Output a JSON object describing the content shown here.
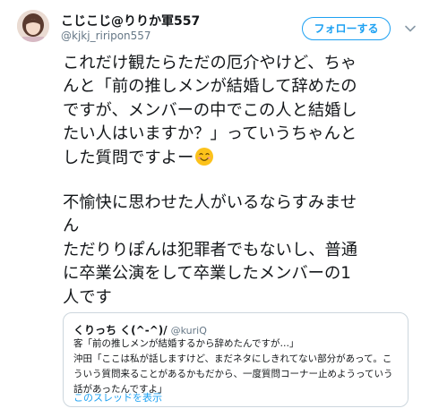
{
  "author": {
    "display_name": "こじこじ@りりか軍557",
    "handle": "@kjkj_riripon557",
    "avatar_icon": "avatar-photo"
  },
  "follow_button": {
    "label": "フォローする"
  },
  "menu_icon": "chevron-down-icon",
  "tweet": {
    "lines": [
      "これだけ観たらただの厄介やけど、ちゃ",
      "んと「前の推しメンが結婚して辞めたの",
      "ですが、メンバーの中でこの人と結婚し",
      "たい人はいますか？」っていうちゃんと",
      "した質問ですよー",
      "不愉快に思わせた人がいるならすみませ",
      "ん",
      "ただりりぽんは犯罪者でもないし、普通",
      "に卒業公演をして卒業したメンバーの1",
      "人です"
    ],
    "emoji": "smiling-face-emoji"
  },
  "quote": {
    "name": "くりっち く(^-^)/",
    "handle": "@kuriQ",
    "lines": [
      "客「前の推しメンが結婚するから辞めたんですが…」",
      "沖田「ここは私が話しますけど、まだネタにしきれてない部分があって。こ",
      "ういう質問来ることがあるかもだから、一度質問コーナー止めようっていう",
      "話があったんですよ」"
    ],
    "thread_link": "このスレッドを表示"
  },
  "colors": {
    "accent": "#1da1f2",
    "text": "#14171a",
    "muted": "#657786",
    "border": "#ccd6dd"
  }
}
